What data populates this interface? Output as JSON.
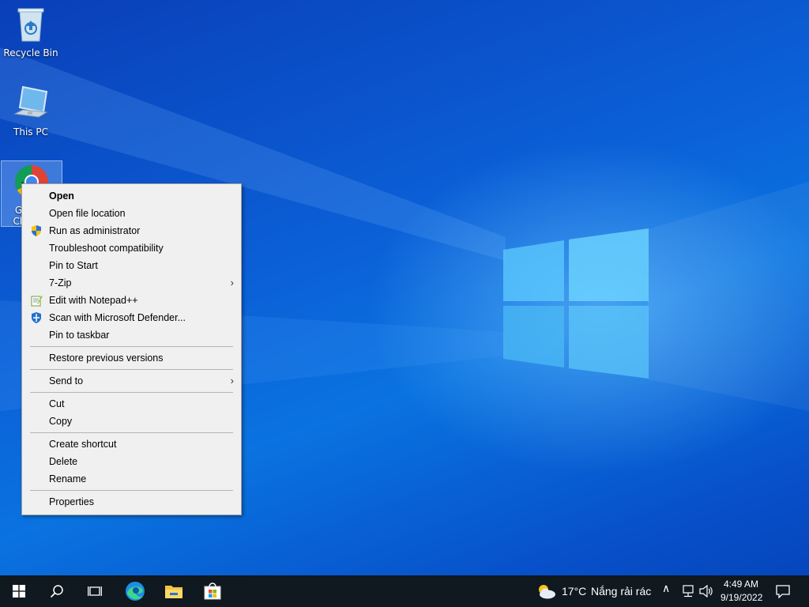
{
  "desktop": {
    "icons": [
      {
        "label": "Recycle Bin"
      },
      {
        "label": "This PC"
      },
      {
        "label": "Google Chrome"
      }
    ]
  },
  "context_menu": {
    "items": {
      "open": "Open",
      "open_file_location": "Open file location",
      "run_as_admin": "Run as administrator",
      "troubleshoot": "Troubleshoot compatibility",
      "pin_to_start": "Pin to Start",
      "seven_zip": "7-Zip",
      "edit_notepad": "Edit with Notepad++",
      "scan_defender": "Scan with Microsoft Defender...",
      "pin_taskbar": "Pin to taskbar",
      "restore_versions": "Restore previous versions",
      "send_to": "Send to",
      "cut": "Cut",
      "copy": "Copy",
      "create_shortcut": "Create shortcut",
      "delete": "Delete",
      "rename": "Rename",
      "properties": "Properties"
    }
  },
  "taskbar": {
    "weather": {
      "temp": "17°C",
      "desc": "Nắng rải rác"
    },
    "clock": {
      "time": "4:49 AM",
      "date": "9/19/2022"
    }
  },
  "colors": {
    "accent": "#0a5fd6",
    "taskbar": "#101820",
    "menu_bg": "#f0f0f0"
  }
}
